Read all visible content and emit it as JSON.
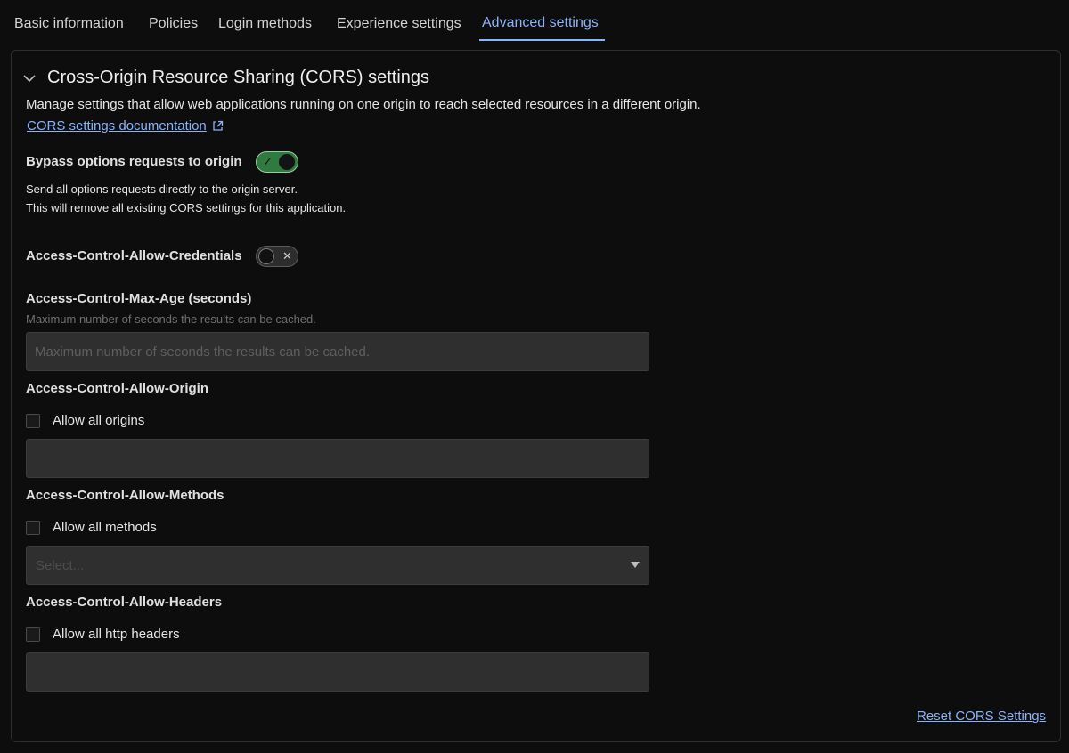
{
  "tabs": [
    {
      "label": "Basic information",
      "active": false
    },
    {
      "label": "Policies",
      "active": false
    },
    {
      "label": "Login methods",
      "active": false
    },
    {
      "label": "Experience settings",
      "active": false
    },
    {
      "label": "Advanced settings",
      "active": true
    }
  ],
  "cors": {
    "title": "Cross-Origin Resource Sharing (CORS) settings",
    "description": "Manage settings that allow web applications running on one origin to reach selected resources in a different origin.",
    "doc_link": "CORS settings documentation",
    "bypass": {
      "label": "Bypass options requests to origin",
      "enabled": true,
      "help_line1": "Send all options requests directly to the origin server.",
      "help_line2": "This will remove all existing CORS settings for this application."
    },
    "credentials": {
      "label": "Access-Control-Allow-Credentials",
      "enabled": false
    },
    "max_age": {
      "label": "Access-Control-Max-Age (seconds)",
      "hint": "Maximum number of seconds the results can be cached.",
      "placeholder": "Maximum number of seconds the results can be cached.",
      "value": ""
    },
    "allow_origin": {
      "label": "Access-Control-Allow-Origin",
      "checkbox_label": "Allow all origins",
      "checked": false,
      "value": ""
    },
    "allow_methods": {
      "label": "Access-Control-Allow-Methods",
      "checkbox_label": "Allow all methods",
      "checked": false,
      "select_placeholder": "Select..."
    },
    "allow_headers": {
      "label": "Access-Control-Allow-Headers",
      "checkbox_label": "Allow all http headers",
      "checked": false,
      "value": ""
    },
    "reset_label": "Reset CORS Settings"
  },
  "icons": {
    "toggle_on_glyph": "✓",
    "toggle_off_glyph": "✕"
  },
  "colors": {
    "accent": "#8ab4f8",
    "toggle_on": "#2f7a3f"
  }
}
